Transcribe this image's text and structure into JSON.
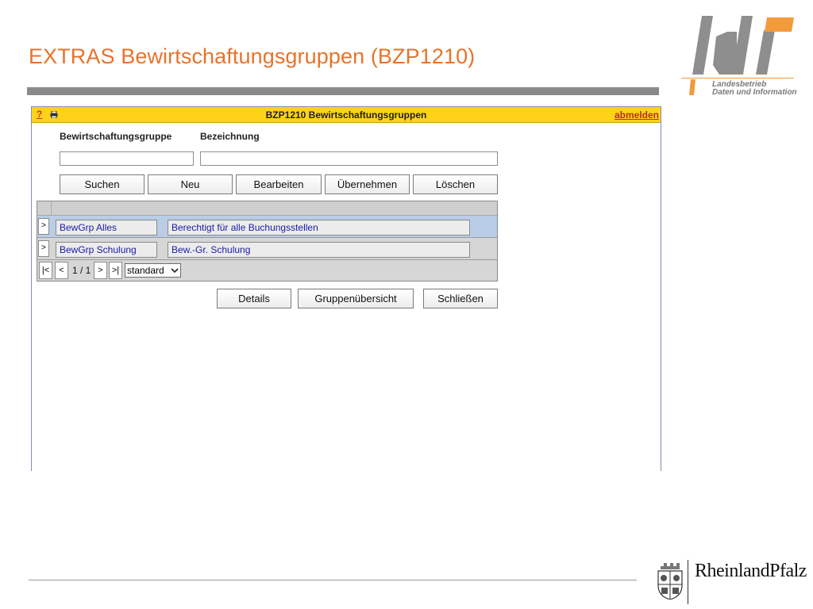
{
  "slide": {
    "title": "EXTRAS Bewirtschaftungsgruppen (BZP1210)",
    "accent_color": "#e8732a",
    "logo": {
      "text_line1": "Landesbetrieb",
      "text_line2": "Daten und Information"
    },
    "footer_brand": "RheinlandPfalz"
  },
  "app": {
    "help_label": "?",
    "print_icon": "printer-icon",
    "title": "BZP1210 Bewirtschaftungsgruppen",
    "logout_label": "abmelden",
    "titlebar_color": "#ffd21a",
    "filters": {
      "group_label": "Bewirtschaftungsgruppe",
      "group_value": "",
      "description_label": "Bezeichnung",
      "description_value": ""
    },
    "action_buttons": {
      "search": "Suchen",
      "new": "Neu",
      "edit": "Bearbeiten",
      "apply": "Übernehmen",
      "delete": "Löschen"
    },
    "rows": [
      {
        "selector": ">",
        "group": "BewGrp Alles",
        "description": "Berechtigt für alle Buchungsstellen",
        "selected": true
      },
      {
        "selector": ">",
        "group": "BewGrp Schulung",
        "description": "Bew.-Gr. Schulung",
        "selected": false
      }
    ],
    "pager": {
      "first": "|<",
      "prev": "<",
      "page_info": "1 / 1",
      "next": ">",
      "last": ">|",
      "view_selected": "standard"
    },
    "bottom_buttons": {
      "details": "Details",
      "group_overview": "Gruppenübersicht",
      "close": "Schließen"
    }
  }
}
